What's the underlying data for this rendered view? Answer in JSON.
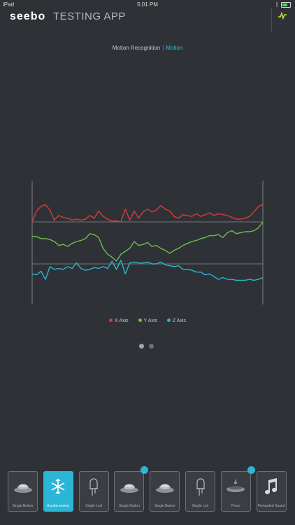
{
  "status_bar": {
    "carrier": "iPad",
    "time": "5:01 PM"
  },
  "header": {
    "brand": "seebo",
    "title": "TESTING APP",
    "pulse_icon": "activity-pulse-icon",
    "accent": "#c7d94a"
  },
  "tabs": {
    "motion_recognition": "Motion Recognition",
    "separator": "|",
    "motion": "Motion"
  },
  "colors": {
    "x": "#e0383c",
    "y": "#6cbf4c",
    "z": "#2bb5d6",
    "grid": "#8a8f94"
  },
  "chart_data": {
    "type": "line",
    "x": [
      0,
      1,
      2,
      3,
      4,
      5,
      6,
      7,
      8,
      9,
      10,
      11,
      12,
      13,
      14,
      15,
      16,
      17,
      18,
      19,
      20,
      21,
      22,
      23,
      24,
      25,
      26,
      27,
      28,
      29,
      30,
      31,
      32,
      33,
      34,
      35,
      36,
      37,
      38,
      39,
      40,
      41,
      42,
      43,
      44,
      45,
      46,
      47,
      48,
      49,
      50,
      51,
      52
    ],
    "series": [
      {
        "name": "X Axis",
        "values": [
          0.0,
          0.6,
          0.85,
          0.95,
          0.65,
          0.1,
          0.35,
          0.25,
          0.2,
          0.1,
          0.15,
          0.1,
          0.15,
          0.35,
          0.2,
          0.6,
          0.3,
          0.15,
          0.05,
          0.05,
          0.0,
          0.7,
          0.1,
          0.6,
          0.2,
          0.55,
          0.7,
          0.55,
          0.65,
          0.9,
          0.7,
          0.6,
          0.3,
          0.2,
          0.4,
          0.35,
          0.3,
          0.45,
          0.3,
          0.4,
          0.5,
          0.35,
          0.45,
          0.4,
          0.35,
          0.25,
          0.15,
          0.15,
          0.2,
          0.3,
          0.55,
          0.85,
          0.95
        ]
      },
      {
        "name": "Y Axis",
        "values": [
          0.25,
          0.25,
          0.15,
          0.15,
          0.1,
          0.0,
          -0.2,
          -0.15,
          -0.25,
          -0.1,
          0.0,
          0.05,
          0.15,
          0.4,
          0.35,
          0.2,
          -0.35,
          -0.65,
          -0.8,
          -1.0,
          -0.65,
          -0.5,
          -0.35,
          0.0,
          -0.2,
          -0.15,
          -0.05,
          -0.25,
          -0.2,
          -0.35,
          -0.45,
          -0.6,
          -0.45,
          -0.35,
          -0.2,
          -0.1,
          0.0,
          0.05,
          0.15,
          0.2,
          0.3,
          0.3,
          0.35,
          0.2,
          0.45,
          0.55,
          0.4,
          0.45,
          0.5,
          0.5,
          0.55,
          0.7,
          1.0
        ]
      },
      {
        "name": "Z Axis",
        "values": [
          -0.55,
          -0.6,
          -0.4,
          -0.85,
          -0.15,
          -0.3,
          -0.25,
          -0.3,
          -0.15,
          -0.25,
          0.05,
          -0.25,
          -0.35,
          -0.3,
          -0.2,
          -0.25,
          -0.15,
          -0.25,
          0.15,
          -0.3,
          0.2,
          -0.55,
          0.05,
          0.1,
          0.05,
          0.05,
          0.1,
          0.0,
          0.0,
          0.1,
          -0.05,
          -0.1,
          -0.15,
          -0.1,
          -0.3,
          -0.3,
          -0.35,
          -0.45,
          -0.45,
          -0.6,
          -0.55,
          -0.7,
          -0.85,
          -0.75,
          -0.85,
          -0.85,
          -0.9,
          -0.9,
          -0.9,
          -0.85,
          -0.9,
          -0.85,
          -0.75
        ]
      }
    ],
    "title": "",
    "xlabel": "",
    "ylabel": "",
    "ylim": [
      -1,
      1
    ],
    "grid": false,
    "legend": "bottom-center"
  },
  "legend": [
    "X Axis",
    "Y Axis",
    "Z Axis"
  ],
  "pager": {
    "pages": 2,
    "current": 1
  },
  "toolbar": {
    "items": [
      {
        "label": "Single Button",
        "icon": "push-button-icon",
        "active": false,
        "badge": false
      },
      {
        "label": "Accelerometer",
        "icon": "accelerometer-icon",
        "active": true,
        "badge": false
      },
      {
        "label": "Single Led",
        "icon": "led-bulb-icon",
        "active": false,
        "badge": false
      },
      {
        "label": "Single Button",
        "icon": "push-button-icon",
        "active": false,
        "badge": true
      },
      {
        "label": "Single Button",
        "icon": "push-button-icon",
        "active": false,
        "badge": false
      },
      {
        "label": "Single Led",
        "icon": "led-bulb-icon",
        "active": false,
        "badge": false
      },
      {
        "label": "Piezo",
        "icon": "piezo-icon",
        "active": false,
        "badge": true
      },
      {
        "label": "Preloaded Sound",
        "icon": "music-note-icon",
        "active": false,
        "badge": false
      }
    ]
  }
}
